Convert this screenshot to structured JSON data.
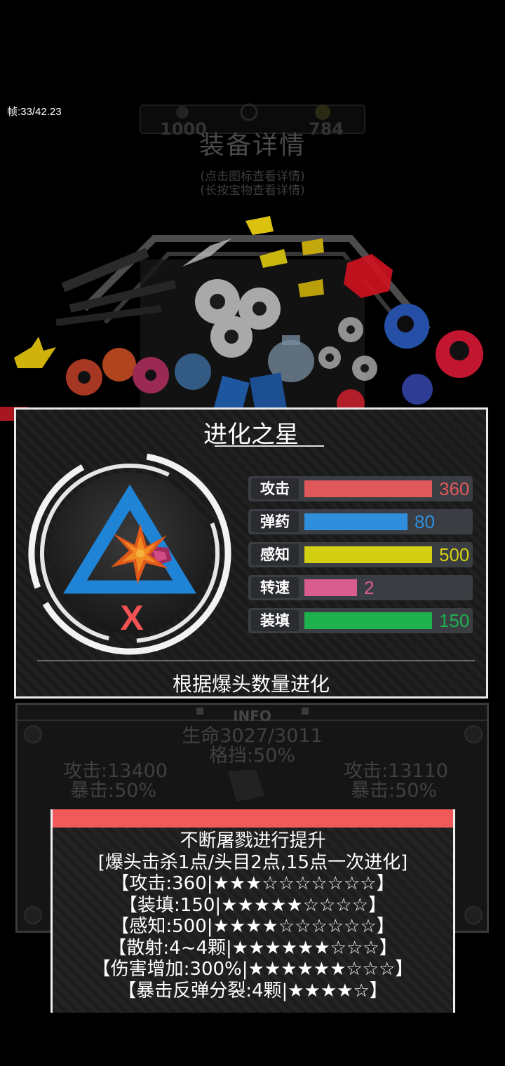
{
  "debug": {
    "fps_text": "帧:33/42.23"
  },
  "header": {
    "title": "装备详情",
    "hint1": "(点击图标查看详情)",
    "hint2": "(长按宝物查看详情)",
    "faded_left": "1000",
    "faded_right": "784"
  },
  "card": {
    "title": "进化之星",
    "badge_text": "X",
    "stats": [
      {
        "label": "攻击",
        "value": "360",
        "fill": 1.0,
        "color": "#e0585a"
      },
      {
        "label": "弹药",
        "value": "80",
        "fill": 0.81,
        "color": "#2f8fdc"
      },
      {
        "label": "感知",
        "value": "500",
        "fill": 1.0,
        "color": "#d3cf11"
      },
      {
        "label": "转速",
        "value": "2",
        "fill": 0.41,
        "color": "#da5d8f"
      },
      {
        "label": "装填",
        "value": "150",
        "fill": 1.0,
        "color": "#1fb14e"
      }
    ],
    "description": "根据爆头数量进化"
  },
  "info": {
    "label": "INFO",
    "hp": "生命3027/3011",
    "block": "格挡:50%",
    "left_attack": "攻击:13400",
    "left_crit": "暴击:50%",
    "right_attack": "攻击:13110",
    "right_crit": "暴击:50%"
  },
  "tooltip": {
    "lines": [
      "不断屠戮进行提升",
      "[爆头击杀1点/头目2点,15点一次进化]",
      "【攻击:360|★★★☆☆☆☆☆☆☆】",
      "【装填:150|★★★★★☆☆☆☆】",
      "【感知:500|★★★★☆☆☆☆☆☆】",
      "【散射:4~4颗|★★★★★★☆☆☆】",
      "【伤害增加:300%|★★★★★★☆☆☆】",
      "【暴击反弹分裂:4颗|★★★★☆】"
    ]
  },
  "colors": {
    "accent_red": "#f05a5a",
    "triangle_blue": "#1f83d6",
    "badge_red": "#f25252"
  }
}
